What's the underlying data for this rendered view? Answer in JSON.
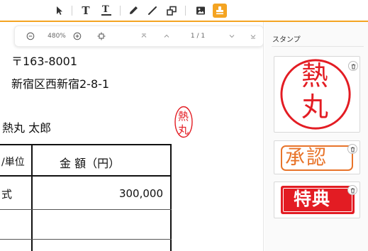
{
  "toolbar": {
    "tools": [
      {
        "icon": "select-pointer-icon",
        "active": false
      },
      {
        "icon": "text-icon",
        "label": "T",
        "active": false
      },
      {
        "icon": "text-edit-icon",
        "label": "T",
        "active": false
      },
      {
        "icon": "pen-icon",
        "active": false
      },
      {
        "icon": "line-icon",
        "active": false
      },
      {
        "icon": "shapes-icon",
        "active": false
      },
      {
        "icon": "image-icon",
        "active": false
      },
      {
        "icon": "stamp-icon",
        "active": true
      }
    ],
    "accent_color": "#f4a422"
  },
  "page_controls": {
    "zoom": "480%",
    "page_indicator": "1 / 1"
  },
  "document": {
    "postal_code": "〒163-8001",
    "address": "新宿区西新宿2-8-1",
    "recipient": "熱丸 太郎",
    "table": {
      "header_left": "/単位",
      "header_right": "金 額（円）",
      "row1_left": "式",
      "row1_right": "300,000"
    },
    "stamp_text": [
      "熱",
      "丸"
    ]
  },
  "panel": {
    "title": "スタンプ",
    "stamps": [
      {
        "name": "round-name-stamp",
        "text": "熱丸",
        "color": "#e31c23"
      },
      {
        "name": "approval-stamp",
        "text": "承認",
        "color": "#e8742a"
      },
      {
        "name": "tokuten-stamp",
        "text": "特典",
        "color": "#e31c23"
      }
    ]
  }
}
